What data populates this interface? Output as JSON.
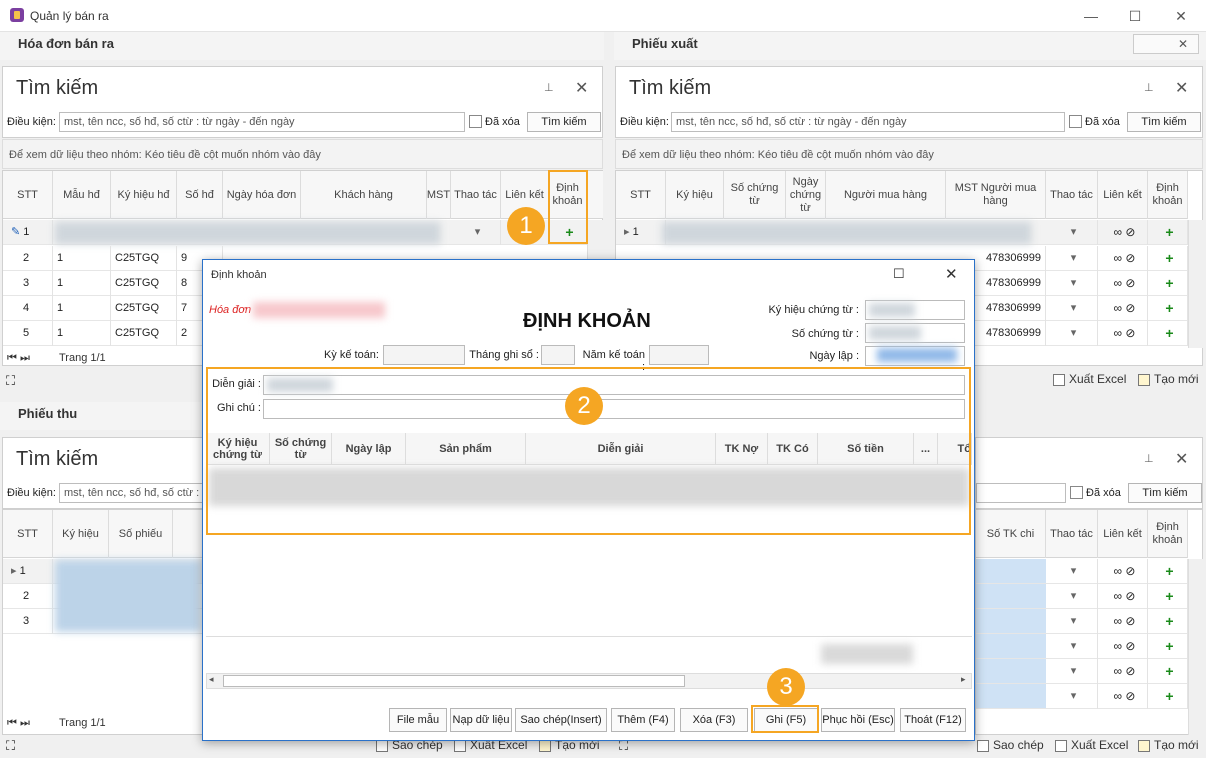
{
  "app": {
    "title": "Quản lý bán ra"
  },
  "window_controls": {
    "minimize": "—",
    "maximize": "☐",
    "close": "✕"
  },
  "sections": {
    "invoice": "Hóa đơn bán ra",
    "export": "Phiếu xuất",
    "receipt": "Phiếu thu"
  },
  "search": {
    "title": "Tìm kiếm",
    "condition_label": "Điều kiện:",
    "placeholder": "mst, tên ncc, số hđ, số ctừ : từ ngày - đến ngày",
    "deleted_label": "Đã xóa",
    "search_button": "Tìm kiếm",
    "pin": "⊥",
    "close": "✕"
  },
  "group_hint": "Để xem dữ liệu theo nhóm: Kéo tiêu đề cột muốn nhóm vào đây",
  "invoice_grid": {
    "headers": [
      "STT",
      "Mẫu hđ",
      "Ký hiệu hđ",
      "Số hđ",
      "Ngày hóa đơn",
      "Khách hàng",
      "MST",
      "Thao tác",
      "Liên kết",
      "Định khoản"
    ],
    "rows": [
      {
        "stt": "1",
        "mau": "",
        "kh": "",
        "so": ""
      },
      {
        "stt": "2",
        "mau": "1",
        "kh": "C25TGQ",
        "so": "9"
      },
      {
        "stt": "3",
        "mau": "1",
        "kh": "C25TGQ",
        "so": "8"
      },
      {
        "stt": "4",
        "mau": "1",
        "kh": "C25TGQ",
        "so": "7"
      },
      {
        "stt": "5",
        "mau": "1",
        "kh": "C25TGQ",
        "so": "2"
      }
    ],
    "page": "Trang 1/1"
  },
  "export_grid": {
    "headers": [
      "STT",
      "Ký hiệu",
      "Số chứng từ",
      "Ngày chứng từ",
      "Người mua hàng",
      "MST Người mua hàng",
      "Thao tác",
      "Liên kết",
      "Định khoản"
    ],
    "rows": [
      {
        "stt": "1",
        "mst": ""
      },
      {
        "stt": "2",
        "mst": "478306999"
      },
      {
        "stt": "3",
        "mst": "478306999"
      },
      {
        "stt": "4",
        "mst": "478306999"
      },
      {
        "stt": "5",
        "mst": "478306999"
      }
    ],
    "export_excel": "Xuất Excel",
    "new": "Tạo mới"
  },
  "receipt_grid": {
    "headers": [
      "STT",
      "Ký hiệu",
      "Số phiếu"
    ],
    "rows": [
      "1",
      "2",
      "3"
    ],
    "page": "Trang 1/1"
  },
  "receipt_right": {
    "headers": [
      "Số TK chi",
      "Thao tác",
      "Liên kết",
      "Định khoản"
    ]
  },
  "bottom_tools": {
    "copy": "Sao chép",
    "export_excel": "Xuất Excel",
    "new": "Tạo mới"
  },
  "dialog": {
    "title": "Định khoản",
    "invoice_tag": "Hóa đơn",
    "heading": "ĐỊNH KHOẢN",
    "ky_ke_toan": "Kỳ kế toán:",
    "thang_ghi_so": "Tháng ghi sổ :",
    "nam_ke_toan": "Năm kế toán :",
    "ky_hieu_ct": "Ký hiệu chứng từ :",
    "so_ct": "Số chứng từ :",
    "ngay_lap": "Ngày lập :",
    "dien_giai": "Diễn giải :",
    "ghi_chu": "Ghi chú :",
    "columns": [
      "Ký hiệu chứng từ",
      "Số chứng từ",
      "Ngày lập",
      "Sản phẩm",
      "Diễn giải",
      "TK Nợ",
      "TK Có",
      "Số tiền",
      "...",
      "Tổ"
    ],
    "buttons": [
      "File mẫu",
      "Nạp dữ liệu",
      "Sao chép(Insert)",
      "Thêm (F4)",
      "Xóa (F3)",
      "Ghi (F5)",
      "Phục hồi (Esc)",
      "Thoát (F12)"
    ]
  },
  "badges": [
    "1",
    "2",
    "3"
  ],
  "accent": "#f5a623"
}
